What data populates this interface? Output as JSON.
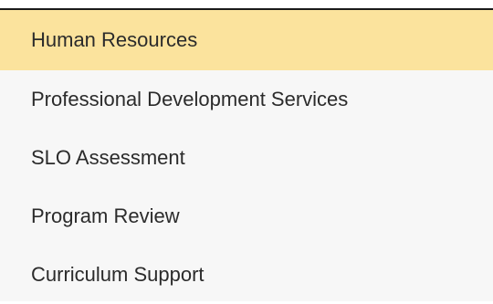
{
  "menu": {
    "active_color": "#fbe39d",
    "items": [
      {
        "label": "Human Resources",
        "active": true
      },
      {
        "label": "Professional Development Services",
        "active": false
      },
      {
        "label": "SLO Assessment",
        "active": false
      },
      {
        "label": "Program Review",
        "active": false
      },
      {
        "label": "Curriculum Support",
        "active": false
      }
    ]
  }
}
